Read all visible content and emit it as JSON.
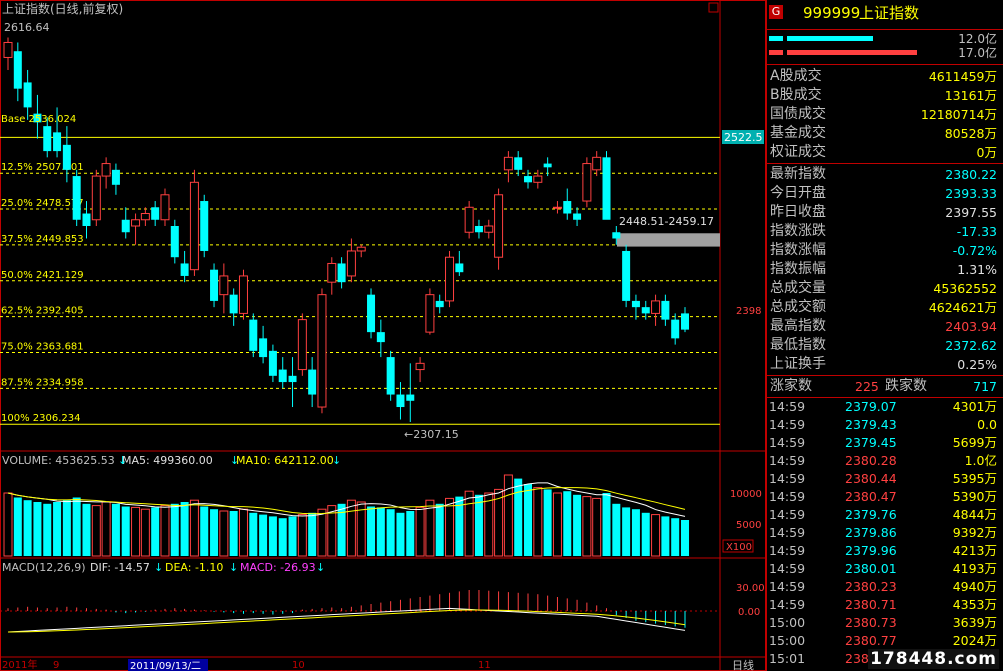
{
  "title": "上证指数(日线,前复权)",
  "high_marker": "2616.64",
  "low_marker": "←2307.15",
  "base_label": "Base 2536.024",
  "fib_levels": [
    {
      "label": "12.5% 2507.301",
      "price": 2507.301
    },
    {
      "label": "25.0% 2478.577",
      "price": 2478.577
    },
    {
      "label": "37.5% 2449.853",
      "price": 2449.853
    },
    {
      "label": "50.0% 2421.129",
      "price": 2421.129
    },
    {
      "label": "62.5% 2392.405",
      "price": 2392.405
    },
    {
      "label": "75.0% 2363.681",
      "price": 2363.681
    },
    {
      "label": "87.5% 2334.958",
      "price": 2334.958
    },
    {
      "label": "100% 2306.234",
      "price": 2306.234
    }
  ],
  "gap_label": "2448.51-2459.17",
  "gap": {
    "low": 2448.51,
    "high": 2459.17
  },
  "price_axis": {
    "current_tag": "2522.5",
    "current_price": 2522.5,
    "mid_label": "2398",
    "mid_price": 2398
  },
  "volume_header": {
    "volume": "VOLUME: 453625.53",
    "ma5": "MA5: 499360.00",
    "ma10": "MA10: 642112.00"
  },
  "volume_axis": {
    "high": "10000",
    "mid": "5000",
    "unit": "X100"
  },
  "macd_header": {
    "params": "MACD(12,26,9)",
    "dif": "DIF: -14.57",
    "dea": "DEA: -1.10",
    "macd": "MACD: -26.93"
  },
  "macd_axis": {
    "high": "30.00",
    "zero": "0.00"
  },
  "date_axis": {
    "left": "2011年",
    "m9": "9",
    "highlight": "2011/09/13/二",
    "m10": "10",
    "m11": "11",
    "period": "日线"
  },
  "chart_data": {
    "type": "candlestick",
    "ylim": [
      2300,
      2630
    ],
    "candles": [
      [
        2600,
        2616,
        2590,
        2612
      ],
      [
        2605,
        2612,
        2565,
        2575
      ],
      [
        2580,
        2590,
        2550,
        2560
      ],
      [
        2555,
        2570,
        2535,
        2548
      ],
      [
        2545,
        2552,
        2520,
        2525
      ],
      [
        2540,
        2560,
        2520,
        2525
      ],
      [
        2530,
        2545,
        2500,
        2510
      ],
      [
        2505,
        2510,
        2465,
        2470
      ],
      [
        2475,
        2485,
        2455,
        2465
      ],
      [
        2470,
        2510,
        2465,
        2505
      ],
      [
        2505,
        2520,
        2495,
        2515
      ],
      [
        2510,
        2515,
        2490,
        2498
      ],
      [
        2470,
        2480,
        2455,
        2460
      ],
      [
        2465,
        2475,
        2450,
        2470
      ],
      [
        2470,
        2480,
        2465,
        2475
      ],
      [
        2480,
        2485,
        2465,
        2470
      ],
      [
        2470,
        2495,
        2465,
        2490
      ],
      [
        2465,
        2470,
        2435,
        2440
      ],
      [
        2435,
        2445,
        2420,
        2425
      ],
      [
        2430,
        2510,
        2425,
        2500
      ],
      [
        2485,
        2490,
        2440,
        2445
      ],
      [
        2430,
        2435,
        2400,
        2405
      ],
      [
        2410,
        2435,
        2395,
        2425
      ],
      [
        2410,
        2415,
        2385,
        2395
      ],
      [
        2395,
        2430,
        2390,
        2425
      ],
      [
        2390,
        2395,
        2360,
        2365
      ],
      [
        2375,
        2385,
        2355,
        2360
      ],
      [
        2365,
        2370,
        2340,
        2345
      ],
      [
        2350,
        2360,
        2335,
        2340
      ],
      [
        2345,
        2360,
        2320,
        2340
      ],
      [
        2350,
        2395,
        2345,
        2390
      ],
      [
        2350,
        2360,
        2320,
        2330
      ],
      [
        2320,
        2415,
        2315,
        2410
      ],
      [
        2420,
        2440,
        2410,
        2435
      ],
      [
        2435,
        2440,
        2415,
        2420
      ],
      [
        2425,
        2455,
        2420,
        2445
      ],
      [
        2445,
        2450,
        2440,
        2448
      ],
      [
        2410,
        2415,
        2375,
        2380
      ],
      [
        2380,
        2390,
        2360,
        2372
      ],
      [
        2360,
        2365,
        2325,
        2330
      ],
      [
        2330,
        2340,
        2310,
        2320
      ],
      [
        2330,
        2355,
        2308,
        2325
      ],
      [
        2350,
        2360,
        2340,
        2355
      ],
      [
        2380,
        2415,
        2378,
        2410
      ],
      [
        2405,
        2410,
        2395,
        2400
      ],
      [
        2405,
        2445,
        2400,
        2440
      ],
      [
        2435,
        2445,
        2425,
        2428
      ],
      [
        2460,
        2485,
        2455,
        2480
      ],
      [
        2465,
        2470,
        2455,
        2460
      ],
      [
        2460,
        2470,
        2455,
        2465
      ],
      [
        2440,
        2495,
        2430,
        2490
      ],
      [
        2510,
        2525,
        2500,
        2520
      ],
      [
        2520,
        2525,
        2505,
        2510
      ],
      [
        2505,
        2510,
        2495,
        2500
      ],
      [
        2500,
        2510,
        2495,
        2505
      ],
      [
        2515,
        2520,
        2505,
        2512
      ],
      [
        2480,
        2485,
        2475,
        2480
      ],
      [
        2485,
        2495,
        2470,
        2475
      ],
      [
        2475,
        2480,
        2465,
        2470
      ],
      [
        2485,
        2520,
        2480,
        2515
      ],
      [
        2510,
        2525,
        2505,
        2520
      ],
      [
        2520,
        2525,
        2475,
        2470
      ],
      [
        2460,
        2465,
        2450,
        2455
      ],
      [
        2445,
        2450,
        2400,
        2405
      ],
      [
        2405,
        2410,
        2390,
        2400
      ],
      [
        2400,
        2405,
        2390,
        2395
      ],
      [
        2395,
        2410,
        2385,
        2405
      ],
      [
        2405,
        2410,
        2385,
        2390
      ],
      [
        2390,
        2395,
        2370,
        2375
      ],
      [
        2395,
        2400,
        2380,
        2382
      ]
    ],
    "volume": [
      70,
      65,
      62,
      60,
      58,
      60,
      62,
      65,
      58,
      56,
      60,
      58,
      55,
      54,
      52,
      54,
      56,
      58,
      60,
      62,
      55,
      52,
      50,
      50,
      52,
      48,
      46,
      44,
      42,
      44,
      46,
      48,
      52,
      56,
      58,
      62,
      60,
      55,
      54,
      52,
      48,
      50,
      54,
      62,
      58,
      64,
      66,
      72,
      68,
      70,
      74,
      90,
      86,
      80,
      76,
      74,
      70,
      72,
      68,
      66,
      64,
      70,
      58,
      54,
      52,
      48,
      46,
      44,
      42,
      40
    ],
    "macd_bars": [
      4,
      5,
      6,
      5,
      4,
      5,
      6,
      5,
      4,
      3,
      2,
      -2,
      -3,
      -2,
      -1,
      2,
      3,
      4,
      3,
      2,
      1,
      -1,
      -2,
      -3,
      -4,
      -3,
      -4,
      -5,
      -4,
      -3,
      2,
      3,
      4,
      5,
      4,
      6,
      8,
      10,
      12,
      14,
      16,
      18,
      20,
      22,
      24,
      26,
      28,
      30,
      30,
      29,
      28,
      27,
      26,
      25,
      24,
      22,
      20,
      18,
      16,
      12,
      8,
      4,
      -6,
      -10,
      -14,
      -16,
      -18,
      -20,
      -22,
      -24
    ]
  },
  "panel": {
    "code": "999999",
    "name": "上证指数",
    "bar1_value": "12.0亿",
    "bar2_value": "17.0亿",
    "turnover": [
      {
        "label": "A股成交",
        "value": "4611459万"
      },
      {
        "label": "B股成交",
        "value": "13161万"
      },
      {
        "label": "国债成交",
        "value": "12180714万"
      },
      {
        "label": "基金成交",
        "value": "80528万"
      },
      {
        "label": "权证成交",
        "value": "0万"
      }
    ],
    "stats": [
      {
        "label": "最新指数",
        "value": "2380.22",
        "color": "#00ffff"
      },
      {
        "label": "今日开盘",
        "value": "2393.33",
        "color": "#00ffff"
      },
      {
        "label": "昨日收盘",
        "value": "2397.55",
        "color": "#e0e0e0"
      },
      {
        "label": "指数涨跌",
        "value": "-17.33",
        "color": "#00ffff"
      },
      {
        "label": "指数涨幅",
        "value": "-0.72%",
        "color": "#00ffff"
      },
      {
        "label": "指数振幅",
        "value": "1.31%",
        "color": "#e0e0e0"
      },
      {
        "label": "总成交量",
        "value": "45362552",
        "color": "#ffff00"
      },
      {
        "label": "总成交额",
        "value": "4624621万",
        "color": "#ffff00"
      },
      {
        "label": "最高指数",
        "value": "2403.94",
        "color": "#ff4040"
      },
      {
        "label": "最低指数",
        "value": "2372.62",
        "color": "#00ffff"
      },
      {
        "label": "上证换手",
        "value": "0.25%",
        "color": "#e0e0e0"
      }
    ],
    "rise_label": "涨家数",
    "rise_value": "225",
    "fall_label": "跌家数",
    "fall_value": "717",
    "ticks": [
      {
        "time": "14:59",
        "price": "2379.07",
        "vol": "4301万"
      },
      {
        "time": "14:59",
        "price": "2379.43",
        "vol": "0.0"
      },
      {
        "time": "14:59",
        "price": "2379.45",
        "vol": "5699万"
      },
      {
        "time": "14:59",
        "price": "2380.28",
        "vol": "1.0亿"
      },
      {
        "time": "14:59",
        "price": "2380.44",
        "vol": "5395万"
      },
      {
        "time": "14:59",
        "price": "2380.47",
        "vol": "5390万"
      },
      {
        "time": "14:59",
        "price": "2379.76",
        "vol": "4844万"
      },
      {
        "time": "14:59",
        "price": "2379.86",
        "vol": "9392万"
      },
      {
        "time": "14:59",
        "price": "2379.96",
        "vol": "4213万"
      },
      {
        "time": "14:59",
        "price": "2380.01",
        "vol": "4193万"
      },
      {
        "time": "14:59",
        "price": "2380.23",
        "vol": "4940万"
      },
      {
        "time": "14:59",
        "price": "2380.71",
        "vol": "4353万"
      },
      {
        "time": "15:00",
        "price": "2380.73",
        "vol": "3639万"
      },
      {
        "time": "15:00",
        "price": "2380.77",
        "vol": "2024万"
      },
      {
        "time": "15:01",
        "price": "2380.22",
        "vol": ""
      }
    ]
  },
  "watermark": "178448.com"
}
